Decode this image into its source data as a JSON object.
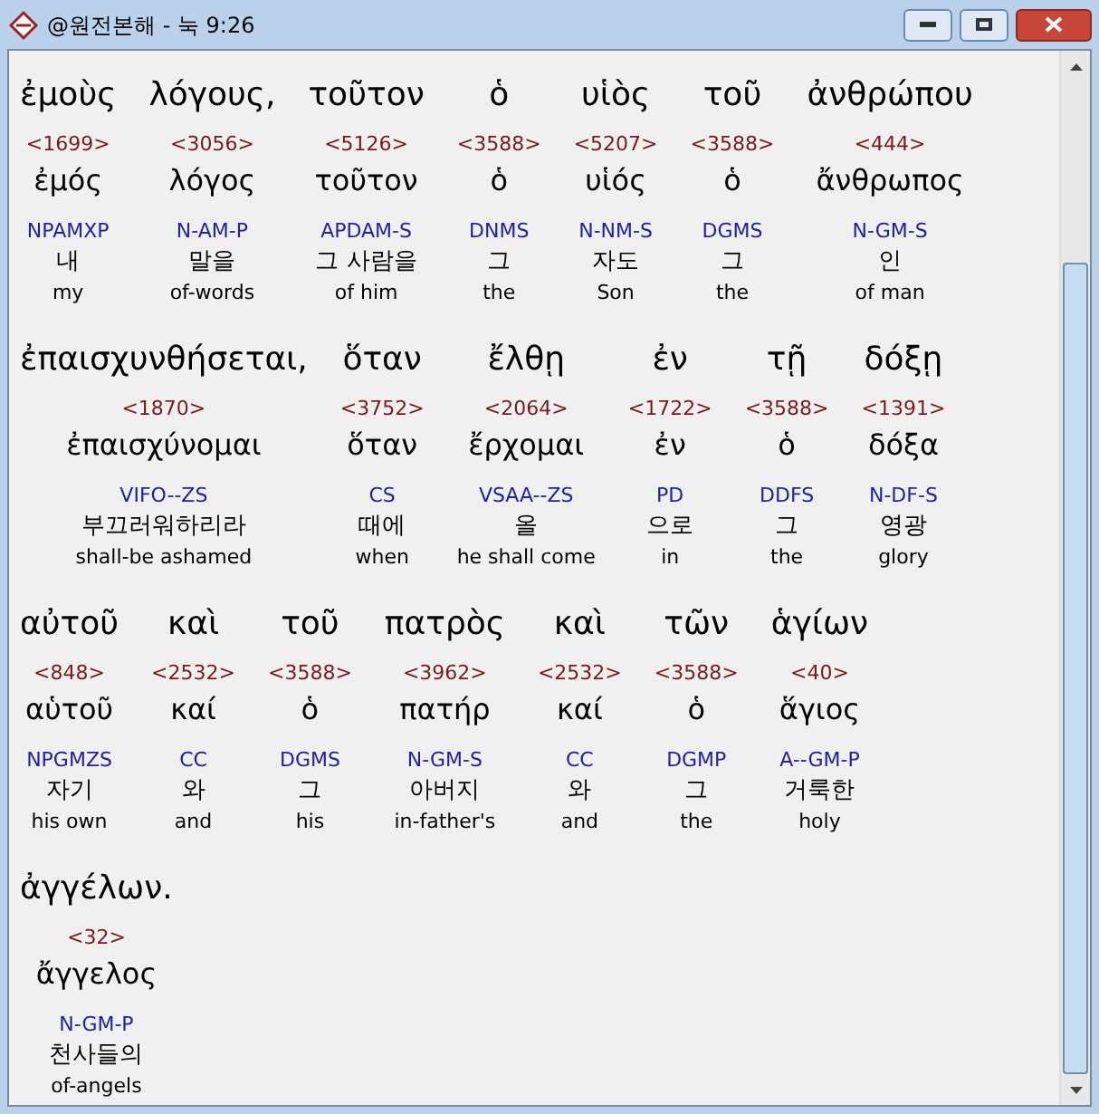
{
  "window": {
    "title": "@원전본해 - 눅 9:26"
  },
  "lines": [
    [
      {
        "greek": "ἐμοὺς",
        "strong": "<1699>",
        "lemma": "ἐμός",
        "parse": "NPAMXP",
        "korean": "내",
        "english": "my"
      },
      {
        "greek": "λόγους,",
        "strong": "<3056>",
        "lemma": "λόγος",
        "parse": "N-AM-P",
        "korean": "말을",
        "english": "of-words"
      },
      {
        "greek": "τοῦτον",
        "strong": "<5126>",
        "lemma": "τοῦτον",
        "parse": "APDAM-S",
        "korean": "그 사람을",
        "english": "of him"
      },
      {
        "greek": "ὁ",
        "strong": "<3588>",
        "lemma": "ὁ",
        "parse": "DNMS",
        "korean": "그",
        "english": "the"
      },
      {
        "greek": "υἱὸς",
        "strong": "<5207>",
        "lemma": "υἱός",
        "parse": "N-NM-S",
        "korean": "자도",
        "english": "Son"
      },
      {
        "greek": "τοῦ",
        "strong": "<3588>",
        "lemma": "ὁ",
        "parse": "DGMS",
        "korean": "그",
        "english": "the"
      },
      {
        "greek": "ἀνθρώπου",
        "strong": "<444>",
        "lemma": "ἄνθρωπος",
        "parse": "N-GM-S",
        "korean": "인",
        "english": "of man"
      }
    ],
    [
      {
        "greek": "ἐπαισχυνθήσεται,",
        "strong": "<1870>",
        "lemma": "ἐπαισχύνομαι",
        "parse": "VIFO--ZS",
        "korean": "부끄러워하리라",
        "english": "shall-be ashamed"
      },
      {
        "greek": "ὅταν",
        "strong": "<3752>",
        "lemma": "ὅταν",
        "parse": "CS",
        "korean": "때에",
        "english": "when"
      },
      {
        "greek": "ἔλθῃ",
        "strong": "<2064>",
        "lemma": "ἔρχομαι",
        "parse": "VSAA--ZS",
        "korean": "올",
        "english": "he shall come"
      },
      {
        "greek": "ἐν",
        "strong": "<1722>",
        "lemma": "ἐν",
        "parse": "PD",
        "korean": "으로",
        "english": "in"
      },
      {
        "greek": "τῇ",
        "strong": "<3588>",
        "lemma": "ὁ",
        "parse": "DDFS",
        "korean": "그",
        "english": "the"
      },
      {
        "greek": "δόξῃ",
        "strong": "<1391>",
        "lemma": "δόξα",
        "parse": "N-DF-S",
        "korean": "영광",
        "english": "glory"
      }
    ],
    [
      {
        "greek": "αὐτοῦ",
        "strong": "<848>",
        "lemma": "αὑτοῦ",
        "parse": "NPGMZS",
        "korean": "자기",
        "english": "his own"
      },
      {
        "greek": "καὶ",
        "strong": "<2532>",
        "lemma": "καί",
        "parse": "CC",
        "korean": "와",
        "english": "and"
      },
      {
        "greek": "τοῦ",
        "strong": "<3588>",
        "lemma": "ὁ",
        "parse": "DGMS",
        "korean": "그",
        "english": "his"
      },
      {
        "greek": "πατρὸς",
        "strong": "<3962>",
        "lemma": "πατήρ",
        "parse": "N-GM-S",
        "korean": "아버지",
        "english": "in-father's"
      },
      {
        "greek": "καὶ",
        "strong": "<2532>",
        "lemma": "καί",
        "parse": "CC",
        "korean": "와",
        "english": "and"
      },
      {
        "greek": "τῶν",
        "strong": "<3588>",
        "lemma": "ὁ",
        "parse": "DGMP",
        "korean": "그",
        "english": "the"
      },
      {
        "greek": "ἁγίων",
        "strong": "<40>",
        "lemma": "ἅγιος",
        "parse": "A--GM-P",
        "korean": "거룩한",
        "english": "holy"
      }
    ],
    [
      {
        "greek": "ἀγγέλων.",
        "strong": "<32>",
        "lemma": "ἄγγελος",
        "parse": "N-GM-P",
        "korean": "천사들의",
        "english": "of-angels"
      }
    ]
  ]
}
